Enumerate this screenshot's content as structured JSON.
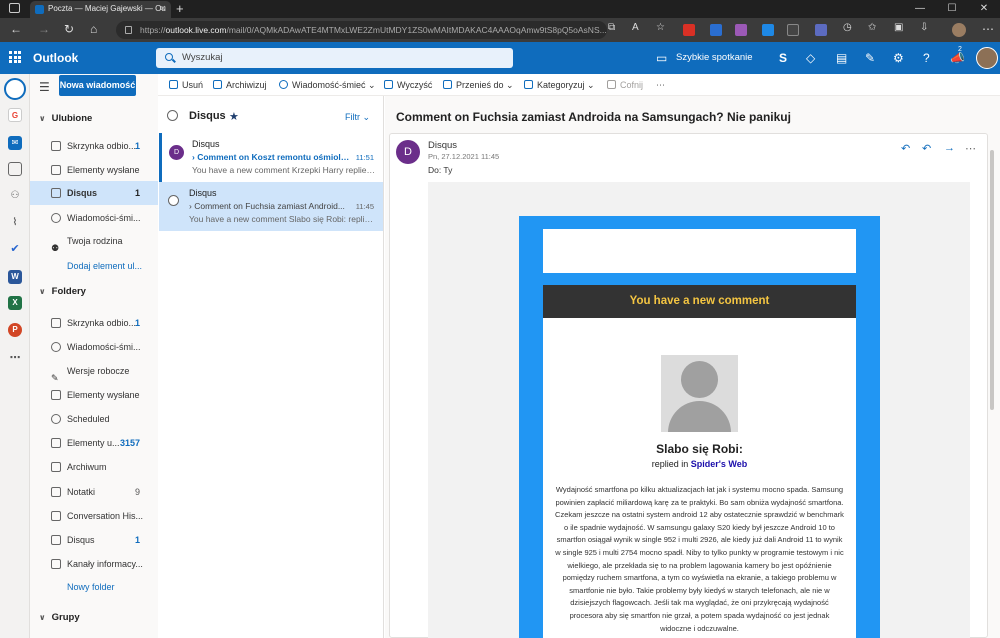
{
  "browser": {
    "tab_title": "Poczta — Maciej Gajewski — Ou",
    "url_host": "outlook.live.com",
    "url_prefix": "https://",
    "url_path": "/mail/0/AQMkADAwATE4MTMxLWE2ZmUtMDY1ZS0wMAItMDAKAC4AAAOqAmw9tS8pQ5oAsNS..."
  },
  "header": {
    "brand": "Outlook",
    "search_placeholder": "Wyszukaj",
    "meet_label": "Szybkie spotkanie",
    "notif_count": "2",
    "accent": "#0f6cbd"
  },
  "folders": {
    "new_message": "Nowa wiadomość",
    "favorites_title": "Ulubione",
    "favorites": [
      {
        "label": "Skrzynka odbio...",
        "count": "1"
      },
      {
        "label": "Elementy wysłane",
        "count": ""
      },
      {
        "label": "Disqus",
        "count": "1"
      },
      {
        "label": "Wiadomości-śmi...",
        "count": ""
      },
      {
        "label": "Twoja rodzina",
        "count": ""
      }
    ],
    "add_favorite": "Dodaj element ul...",
    "folders_title": "Foldery",
    "list": [
      {
        "label": "Skrzynka odbio...",
        "count": "1"
      },
      {
        "label": "Wiadomości-śmi...",
        "count": ""
      },
      {
        "label": "Wersje robocze",
        "count": ""
      },
      {
        "label": "Elementy wysłane",
        "count": ""
      },
      {
        "label": "Scheduled",
        "count": ""
      },
      {
        "label": "Elementy u...",
        "count": "3157"
      },
      {
        "label": "Archiwum",
        "count": ""
      },
      {
        "label": "Notatki",
        "count": "9"
      },
      {
        "label": "Conversation His...",
        "count": ""
      },
      {
        "label": "Disqus",
        "count": "1"
      },
      {
        "label": "Kanały informacy...",
        "count": ""
      }
    ],
    "new_folder": "Nowy folder",
    "groups_title": "Grupy"
  },
  "commands": {
    "delete": "Usuń",
    "archive": "Archiwizuj",
    "junk": "Wiadomość-śmieć",
    "sweep": "Wyczyść",
    "move": "Przenieś do",
    "categorize": "Kategoryzuj",
    "undo": "Cofnij"
  },
  "list": {
    "title": "Disqus",
    "filter": "Filtr",
    "messages": [
      {
        "avatar": "D",
        "from": "Disqus",
        "subject": "Comment on Koszt remontu ośmiole...",
        "time": "11:51",
        "preview": "You have a new comment Krzepki Harry replied ..."
      },
      {
        "avatar": "",
        "from": "Disqus",
        "subject": "Comment on Fuchsia zamiast Android...",
        "time": "11:45",
        "preview": "You have a new comment Slabo się Robi: replie..."
      }
    ]
  },
  "reading": {
    "subject": "Comment on Fuchsia zamiast Androida na Samsungach? Nie panikuj",
    "avatar": "D",
    "from": "Disqus",
    "date": "Pn, 27.12.2021 11:45",
    "to": "Do:  Ty",
    "banner": "You have a new comment",
    "commenter": "Slabo się Robi:",
    "replied_in": "replied in",
    "site": "Spider's Web",
    "body": "Wydajność smartfona po kilku aktualizacjach łat jak i systemu mocno spada. Samsung powinien zapłacić miliardową karę za te praktyki. Bo sam obniża wydajność smartfona. Czekam jeszcze na ostatni system android 12 aby ostatecznie sprawdzić w benchmark o ile spadnie wydajność. W samsungu galaxy S20 kiedy był jeszcze Android 10 to smartfon osiągał wynik w single 952 i multi 2926, ale kiedy już dali Android 11 to wynik w single 925 i multi 2754 mocno spadł. Niby to tylko punkty w programie testowym i nic wielkiego, ale przekłada się to na problem lagowania kamery bo jest opóźnienie pomiędzy ruchem smartfona, a tym co wyświetla na ekranie, a takiego problemu w smartfonie nie było. Takie problemy były kiedyś w starych telefonach, ale nie w dzisiejszych flagowcach. Jeśli tak ma wyglądać, że oni przykręcają wydajność procesora aby się smartfon nie grzał, a potem spada wydajność co jest jednak widoczne i odczuwalne.",
    "banner_color": "#f4c542",
    "frame_color": "#2196f3"
  }
}
